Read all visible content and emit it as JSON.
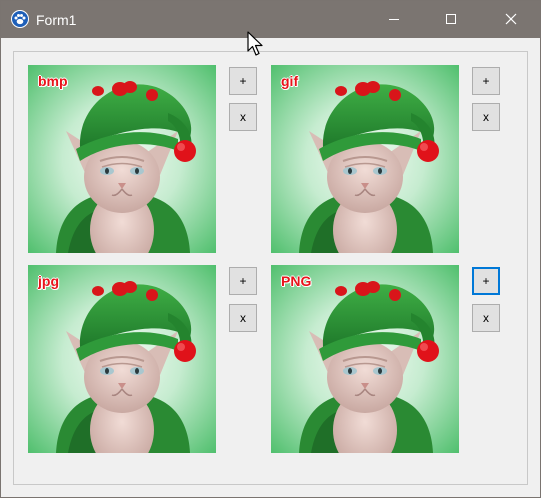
{
  "window": {
    "title": "Form1",
    "icon": "paw-icon",
    "titlebar_color": "#7b7571"
  },
  "panels": [
    {
      "format_label": "bmp",
      "add_label": "+",
      "remove_label": "x"
    },
    {
      "format_label": "gif",
      "add_label": "+",
      "remove_label": "x"
    },
    {
      "format_label": "jpg",
      "add_label": "+",
      "remove_label": "x"
    },
    {
      "format_label": "PNG",
      "add_label": "+",
      "remove_label": "x"
    }
  ],
  "colors": {
    "label_red": "#e8141b",
    "focus_blue": "#0078d7",
    "button_face": "#e1e1e1",
    "photo_bg": "#6fd089"
  }
}
